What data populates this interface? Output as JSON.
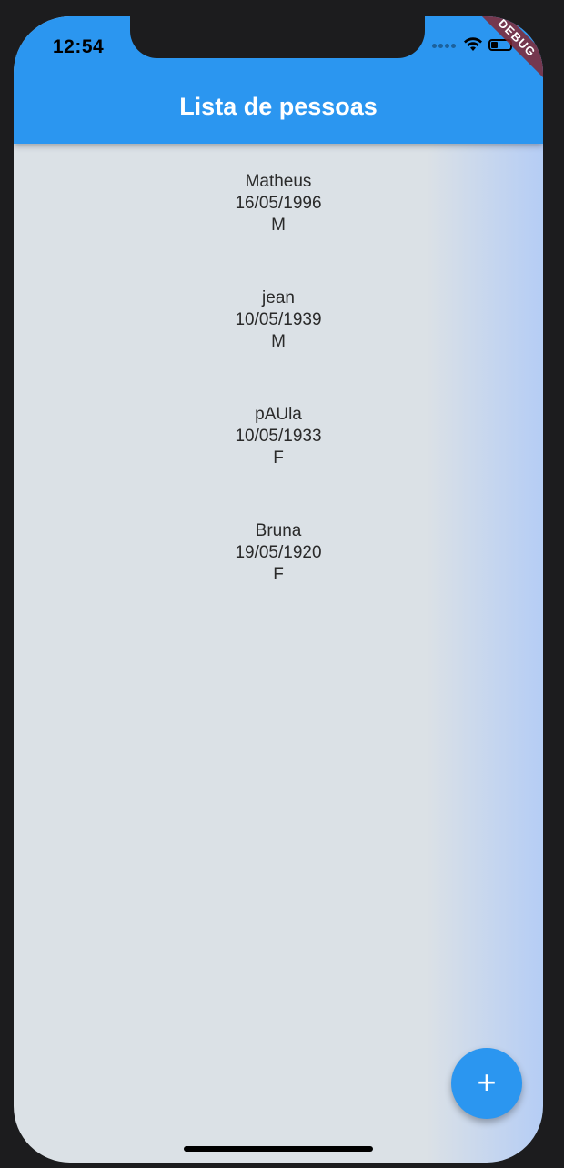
{
  "status_bar": {
    "time": "12:54",
    "battery_level": 0.35
  },
  "debug_banner": {
    "label": "DEBUG"
  },
  "app_bar": {
    "title": "Lista de pessoas"
  },
  "people": [
    {
      "name": "Matheus",
      "birth_date": "16/05/1996",
      "sex": "M"
    },
    {
      "name": "jean",
      "birth_date": "10/05/1939",
      "sex": "M"
    },
    {
      "name": "pAUla",
      "birth_date": "10/05/1933",
      "sex": "F"
    },
    {
      "name": "Bruna",
      "birth_date": "19/05/1920",
      "sex": "F"
    }
  ],
  "fab": {
    "icon": "plus-icon",
    "symbol": "+"
  },
  "colors": {
    "primary": "#2b96f0",
    "background": "#dbe1e6",
    "gradient_end": "#b5cdf5",
    "debug": "#822832"
  }
}
